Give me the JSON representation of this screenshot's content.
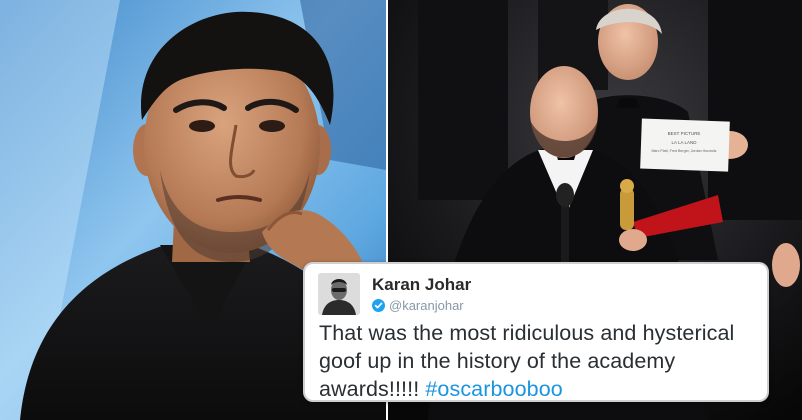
{
  "tweet": {
    "name": "Karan Johar",
    "handle": "@karanjohar",
    "text_lines": [
      "That was the most ridiculous and hysterical",
      "goof up in the history of the academy",
      "awards!!!!! "
    ],
    "hashtag": "#oscarbooboo",
    "hashtag_color": "#1b95e0",
    "verified_color": "#1da1f2"
  },
  "envelope_card_lines": [
    "BEST PICTURE",
    "LA LA LAND",
    "Marc Platt, Fred Berger, Jordan Horowitz"
  ]
}
